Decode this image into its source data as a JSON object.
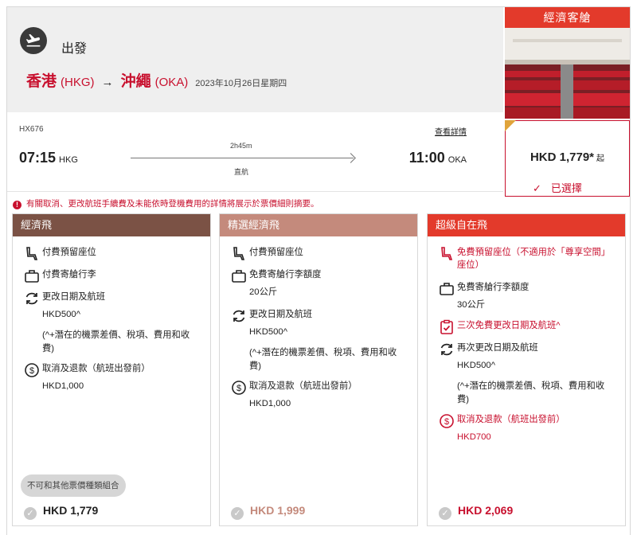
{
  "header": {
    "title": "出發",
    "origin_city": "香港",
    "origin_code": "(HKG)",
    "dest_city": "沖繩",
    "dest_code": "(OKA)",
    "date": "2023年10月26日星期四",
    "arrow": "→"
  },
  "cabin": {
    "title": "經濟客艙",
    "price": "HKD 1,779*",
    "from_label": "起",
    "selected_label": "已選擇",
    "tick": "✓"
  },
  "flight": {
    "number": "HX676",
    "details_link": "查看詳情",
    "depart_time": "07:15",
    "depart_code": "HKG",
    "duration": "2h45m",
    "type": "直航",
    "arrive_time": "11:00",
    "arrive_code": "OKA"
  },
  "notice": {
    "icon_text": "!",
    "text": "有關取消、更改航班手續費及未能依時登機費用的詳情將展示於票價細則摘要。"
  },
  "colors": {
    "brand_red": "#c8102e",
    "fare1_header": "#7b5245",
    "fare2_header": "#c48a7c",
    "fare3_header": "#e33a2b"
  },
  "fares": [
    {
      "name": "經濟飛",
      "seat": "付費預留座位",
      "baggage": "付費寄艙行李",
      "change": "更改日期及航班",
      "change_fee": "HKD500^",
      "change_note": "(^+潛在的機票差價、稅項、費用和收費)",
      "cancel": "取消及退款（航班出發前）",
      "cancel_fee": "HKD1,000",
      "combo_badge": "不可和其他票價種類組合",
      "price": "HKD 1,779",
      "check": "✓"
    },
    {
      "name": "精選經濟飛",
      "seat": "付費預留座位",
      "baggage": "免費寄艙行李額度",
      "baggage_amount": "20公斤",
      "change": "更改日期及航班",
      "change_fee": "HKD500^",
      "change_note": "(^+潛在的機票差價、稅項、費用和收費)",
      "cancel": "取消及退款（航班出發前）",
      "cancel_fee": "HKD1,000",
      "price": "HKD 1,999",
      "check": "✓"
    },
    {
      "name": "超級自在飛",
      "seat": "免費預留座位（不適用於「尊享空間」座位）",
      "baggage": "免費寄艙行李額度",
      "baggage_amount": "30公斤",
      "free_change": "三次免費更改日期及航班^",
      "change": "再次更改日期及航班",
      "change_fee": "HKD500^",
      "change_note": "(^+潛在的機票差價、稅項、費用和收費)",
      "cancel": "取消及退款（航班出發前）",
      "cancel_fee": "HKD700",
      "price": "HKD 2,069",
      "check": "✓"
    }
  ]
}
